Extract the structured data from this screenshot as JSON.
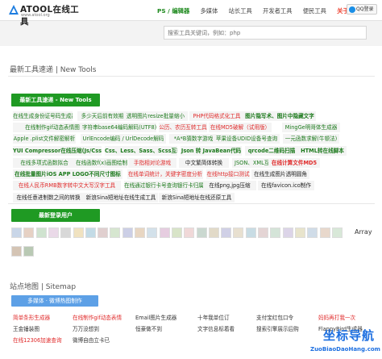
{
  "header": {
    "logo_text": "ATOOL在线工具",
    "logo_sub": "www.atool.org",
    "nav": [
      "PS / 编辑器",
      "多媒体",
      "站长工具",
      "开发者工具",
      "便民工具",
      "关于&合作"
    ],
    "qq_login": "QQ登录"
  },
  "search": {
    "placeholder": "搜索工具关键词，例如：php"
  },
  "new_tools": {
    "title": "最新工具速递 | New Tools",
    "button_label": "最新工具速递 - New Tools",
    "tags": [
      {
        "label": "在线生成身份证号码生成器",
        "style": "green"
      },
      {
        "label": "多少天后前有效期",
        "style": "green"
      },
      {
        "label": "透明图片resize批量缩小",
        "style": "green"
      },
      {
        "label": "PHP代码格式化工具",
        "style": "red"
      },
      {
        "label": "图片隐写术、图片中隐藏文字",
        "style": "green-bold"
      },
      {
        "label": "在线制作gif动态表情图",
        "style": "green"
      },
      {
        "label": "字符串base64编码解码(UTF8)",
        "style": "green"
      },
      {
        "label": "公历、农历互转工具",
        "style": "red"
      },
      {
        "label": "在线MD5破解（试用版）",
        "style": "red"
      },
      {
        "label": "MingGe明哥体生成器",
        "style": "green"
      },
      {
        "label": "Apple .plist文件解密解析",
        "style": "green"
      },
      {
        "label": "UrlEncode编码 / UrlDecode解码",
        "style": "green"
      },
      {
        "label": "*A*B猜数字游戏",
        "style": "green"
      },
      {
        "label": "苹果设备UDID设备号查询",
        "style": "green"
      },
      {
        "label": "一元函数求解(牛顿法)",
        "style": "green"
      },
      {
        "label": "YUI Compressor在线压缩(Js/Css)",
        "style": "green-bold"
      },
      {
        "label": "Css、Less、Sass、Scss互转",
        "style": "green-bold"
      },
      {
        "label": "Json 转 JavaBean代码",
        "style": "green-bold"
      },
      {
        "label": "qrcode二维码扫描",
        "style": "green-bold"
      },
      {
        "label": "HTML转在线脚本",
        "style": "green-bold"
      },
      {
        "label": "在线多项式函数拟合",
        "style": "green"
      },
      {
        "label": "在线函数f(x)画图绘制",
        "style": "green"
      },
      {
        "label": "手指相对论游戏",
        "style": "red"
      },
      {
        "label": "中文繁简体转换",
        "style": "dark"
      },
      {
        "label": "JSON、XML互转",
        "style": "green"
      },
      {
        "label": "在线计算文件MD5",
        "style": "red-bold"
      },
      {
        "label": "在线批量图片iOS APP LOGO不同尺寸图标",
        "style": "green-bold"
      },
      {
        "label": "在线单词统计，关键字密度分析",
        "style": "red"
      },
      {
        "label": "在线http接口测试",
        "style": "red"
      },
      {
        "label": "在线生成图片透明圆角",
        "style": "dark"
      },
      {
        "label": "在线人民币RMB数字转中文大写汉字工具",
        "style": "red"
      },
      {
        "label": "在线通过银行卡号查询银行卡归属行工具",
        "style": "green"
      },
      {
        "label": "在线png,jpg压缩",
        "style": "dark"
      },
      {
        "label": "在线favicon.ico制作",
        "style": "dark"
      },
      {
        "label": "在线任意进制数之间的转换",
        "style": "dark"
      },
      {
        "label": "新浪Sina短地址在线生成工具",
        "style": "dark"
      },
      {
        "label": "新浪Sina短地址在线还原工具",
        "style": "dark"
      }
    ]
  },
  "users": {
    "button_label": "最新登录用户",
    "last_label": "Array"
  },
  "sitemap": {
    "title": "站点地图 | Sitemap",
    "button_label": "多媒体 · 微博热图制作",
    "cells": [
      {
        "label": "简单条形生成器",
        "style": "red"
      },
      {
        "label": "在线制作gif动态表情",
        "style": "red"
      },
      {
        "label": "Email图片生成器",
        "style": "dark"
      },
      {
        "label": "十年我单位订",
        "style": "dark"
      },
      {
        "label": "支付宝红包口令",
        "style": "dark"
      },
      {
        "label": "妈妈再打我一次",
        "style": "red"
      },
      {
        "label": "王金锤装图",
        "style": "dark"
      },
      {
        "label": "万万没想到",
        "style": "dark"
      },
      {
        "label": "恒豪做不到",
        "style": "dark"
      },
      {
        "label": "文字信息标着看",
        "style": "dark"
      },
      {
        "label": "搜索引擎展示后购",
        "style": "dark"
      },
      {
        "label": "FlappyBird生成器",
        "style": "dark"
      },
      {
        "label": "在线12306加速查询",
        "style": "red"
      },
      {
        "label": "微博自由立卡已",
        "style": "dark"
      }
    ]
  },
  "watermark": {
    "zh": "坐标导航",
    "en": "ZuoBiaoDaoHang.com"
  },
  "colors": {
    "green": "#1f9a23",
    "red": "#e02a2a",
    "blue": "#5da0e6",
    "nav_active": "#1f8a1f"
  }
}
